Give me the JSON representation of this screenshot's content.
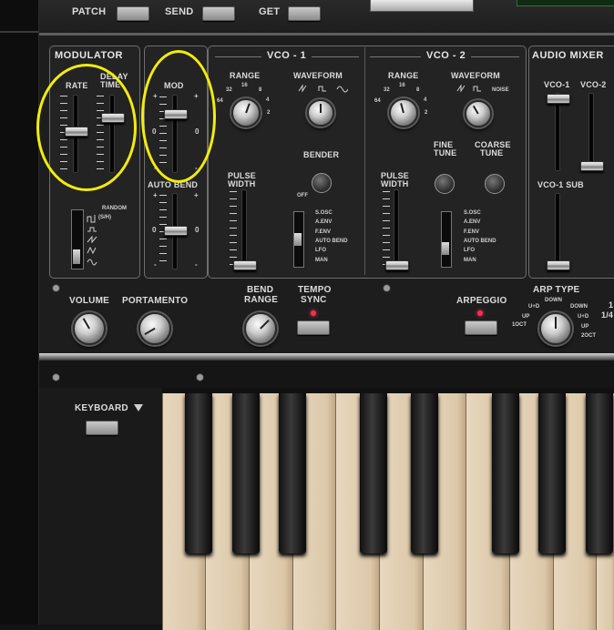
{
  "top": {
    "patch": "PATCH",
    "send": "SEND",
    "get": "GET"
  },
  "modulator": {
    "title": "MODULATOR",
    "rate": "RATE",
    "delay_l1": "DELAY",
    "delay_l2": "TIME",
    "random_l1": "RANDOM",
    "random_l2": "(S/H)"
  },
  "mod": {
    "title": "MOD",
    "auto_bend": "AUTO BEND",
    "plus": "+",
    "minus": "-",
    "zero": "0"
  },
  "vco1": {
    "title": "VCO - 1",
    "range": "RANGE",
    "waveform": "WAVEFORM",
    "range_ticks": [
      "32",
      "16",
      "8",
      "64",
      "4",
      "2"
    ],
    "bender": "BENDER",
    "off": "OFF",
    "pw_l1": "PULSE",
    "pw_l2": "WIDTH",
    "sources": [
      "S.OSC",
      "A.ENV",
      "F.ENV",
      "AUTO BEND",
      "LFO",
      "MAN"
    ]
  },
  "vco2": {
    "title": "VCO - 2",
    "range": "RANGE",
    "waveform": "WAVEFORM",
    "noise": "NOISE",
    "range_ticks": [
      "32",
      "16",
      "8",
      "64",
      "4",
      "2"
    ],
    "fine_l1": "FINE",
    "fine_l2": "TUNE",
    "coarse_l1": "COARSE",
    "coarse_l2": "TUNE",
    "pw_l1": "PULSE",
    "pw_l2": "WIDTH",
    "sources": [
      "S.OSC",
      "A.ENV",
      "F.ENV",
      "AUTO BEND",
      "LFO",
      "MAN"
    ]
  },
  "mixer": {
    "title": "AUDIO MIXER",
    "vco1": "VCO-1",
    "vco2": "VCO-2",
    "vco1sub": "VCO-1 SUB"
  },
  "controls": {
    "volume": "VOLUME",
    "portamento": "PORTAMENTO",
    "bend_l1": "BEND",
    "bend_l2": "RANGE",
    "tempo_l1": "TEMPO",
    "tempo_l2": "SYNC",
    "arpeggio": "ARPEGGIO",
    "arp_type": "ARP TYPE",
    "arp_opts": [
      "DOWN",
      "U+D",
      "DOWN",
      "UP",
      "U+D",
      "1OCT",
      "UP",
      "2OCT"
    ],
    "edge1": "1",
    "edge2": "1/4"
  },
  "keyboard": {
    "label": "KEYBOARD"
  }
}
